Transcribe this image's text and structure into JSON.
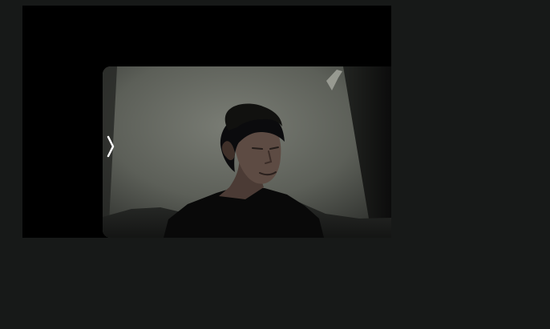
{
  "viewer": {
    "navigation": {
      "next_icon": "chevron-right-icon"
    },
    "video": {
      "content": "camera-feed"
    }
  },
  "colors": {
    "page_background": "#171918",
    "viewer_background": "#000000",
    "wall_light": "#6a6d66",
    "wall_shadow": "#2f322f",
    "hair": "#0d0d0f",
    "skin": "#5c4a43",
    "shirt": "#090909"
  }
}
